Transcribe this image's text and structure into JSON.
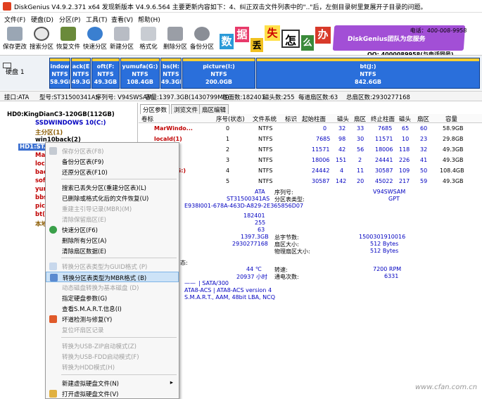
{
  "titlebar": {
    "text": "DiskGenius V4.9.2.371 x64    发现新版本 V4.9.6.564 主要更新内容如下：4、纠正双击文件列表中的\"..\"后，左侧目录树里复展开子目录的问题。"
  },
  "menu": [
    "文件(F)",
    "硬盘(D)",
    "分区(P)",
    "工具(T)",
    "查看(V)",
    "帮助(H)"
  ],
  "toolbar": [
    "保存更改",
    "搜索分区",
    "恢复文件",
    "快速分区",
    "新建分区",
    "格式化",
    "删除分区",
    "备份分区"
  ],
  "banner": {
    "chars": [
      "数",
      "据",
      "丢",
      "失",
      "怎",
      "么",
      "办"
    ],
    "team": "DiskGenius团队为您服务",
    "phone": "电话：400-008-9958",
    "qq": "QQ: 4000089958(与电话同号)"
  },
  "disk_label": {
    "line1": "硬盘 1"
  },
  "partitions": [
    {
      "name": "indow",
      "fs": "NTFS",
      "size": "58.9GB"
    },
    {
      "name": "ack(E",
      "fs": "NTFS",
      "size": "49.3GB"
    },
    {
      "name": "oft(F:",
      "fs": "NTFS",
      "size": "49.3GB"
    },
    {
      "name": "yumufa(G:)",
      "fs": "NTFS",
      "size": "108.4GB"
    },
    {
      "name": "bs(H:",
      "fs": "NTFS",
      "size": "49.3GB"
    },
    {
      "name": "picture(I:)",
      "fs": "NTFS",
      "size": "200.0GB"
    },
    {
      "name": "bt(J:)",
      "fs": "NTFS",
      "size": "842.6GB"
    }
  ],
  "infobar": {
    "iface": "接口:ATA",
    "model": "型号:ST31500341AS",
    "serial": "序列号: V94SWSAM",
    "capacity": "容量:1397.3GB(1430799MB)",
    "cyl": "柱面数:182401",
    "heads": "磁头数:255",
    "spt": "每道扇区数:63",
    "sectors": "总扇区数:2930277168"
  },
  "tree": [
    {
      "text": "HD0:KingDianC3-120GB(112GB)"
    },
    {
      "text": "SSDWINDOWS 10(C:)"
    },
    {
      "text": "主分区(1)"
    },
    {
      "text": "win10back(2)"
    },
    {
      "text": "HD1:ST..."
    },
    {
      "text": "Mar"
    },
    {
      "text": "loc"
    },
    {
      "text": "bac"
    },
    {
      "text": "sof"
    },
    {
      "text": "yum"
    },
    {
      "text": "bbs"
    },
    {
      "text": "pic"
    },
    {
      "text": "bt("
    },
    {
      "text": "本地"
    }
  ],
  "tabs": [
    "分区参数",
    "浏览文件",
    "扇区编辑"
  ],
  "table": {
    "headers": [
      "卷标",
      "序号(状态)",
      "文件系统",
      "标识",
      "起始柱面",
      "磁头",
      "扇区",
      "终止柱面",
      "磁头",
      "扇区",
      "容量"
    ],
    "rows": [
      [
        "MarWindo...",
        "0",
        "NTFS",
        "",
        "0",
        "32",
        "33",
        "7685",
        "65",
        "60",
        "58.9GB"
      ],
      [
        "locald(1)",
        "1",
        "NTFS",
        "",
        "7685",
        "98",
        "30",
        "11571",
        "10",
        "23",
        "29.8GB"
      ],
      [
        ":)",
        "2",
        "NTFS",
        "",
        "11571",
        "42",
        "56",
        "18006",
        "118",
        "32",
        "49.3GB"
      ],
      [
        ":)",
        "3",
        "NTFS",
        "",
        "18006",
        "151",
        "2",
        "24441",
        "226",
        "41",
        "49.3GB"
      ],
      [
        "(G:)",
        "4",
        "NTFS",
        "",
        "24442",
        "4",
        "11",
        "30587",
        "109",
        "50",
        "108.4GB"
      ],
      [
        ")",
        "5",
        "NTFS",
        "",
        "30587",
        "142",
        "20",
        "45022",
        "217",
        "59",
        "49.3GB"
      ]
    ]
  },
  "details": {
    "ata": "ATA",
    "model_val": "ST31500341AS",
    "guid": "E938I001-678A-463D-A829-2E365856D07",
    "sn_label": "序列号:",
    "sn_val": "V94SWSAM",
    "pt_label": "分区表类型:",
    "pt_val": "GPT",
    "cyl": "182401",
    "heads": "255",
    "spt": "63",
    "cap": "1397.3GB",
    "sectors": "2930277168",
    "total_bytes_label": "总字节数:",
    "total_bytes_val": "1500301910016",
    "sector_size_label": "扇区大小:",
    "sector_size_val": "512 Bytes",
    "phys_sector_label": "物理扇区大小:",
    "phys_sector_val": "512 Bytes",
    "temp": "44 ℃",
    "hours": "20937 小时",
    "sata": "| SATA/300",
    "ata_ver": "ATA8-ACS | ATA8-ACS version 4",
    "smart": "S.M.A.R.T., AAM, 48bit LBA, NCQ",
    "rpm_label": "转速:",
    "rpm_val": "7200 RPM",
    "poweron_label": "通电次数:",
    "poweron_val": "6331",
    "state": "态:"
  },
  "context_menu": [
    {
      "label": "保存分区表(F8)",
      "disabled": true
    },
    {
      "label": "备份分区表(F9)",
      "disabled": false
    },
    {
      "label": "还原分区表(F10)",
      "disabled": false
    },
    {
      "label": "搜索已丢失分区(重建分区表)(L)",
      "disabled": false
    },
    {
      "label": "已删除或格式化后的文件恢复(U)",
      "disabled": false
    },
    {
      "label": "重建主引导记录(MBR)(M)",
      "disabled": true
    },
    {
      "label": "清除保留扇区(E)",
      "disabled": true
    },
    {
      "label": "快速分区(F6)",
      "disabled": false
    },
    {
      "label": "删除所有分区(A)",
      "disabled": false
    },
    {
      "label": "清除扇区数据(E)",
      "disabled": false
    },
    {
      "label": "转换分区表类型为GUID格式 (P)",
      "disabled": true
    },
    {
      "label": "转换分区表类型为MBR格式 (B)",
      "disabled": false,
      "highlight": true
    },
    {
      "label": "动态磁盘转换为基本磁盘 (D)",
      "disabled": true
    },
    {
      "label": "指定硬盘参数(G)",
      "disabled": false
    },
    {
      "label": "查看S.M.A.R.T.信息(I)",
      "disabled": false
    },
    {
      "label": "坏道检测与修复(Y)",
      "disabled": false
    },
    {
      "label": "复位坏扇区记录",
      "disabled": true
    },
    {
      "label": "转换为USB-ZIP启动模式(Z)",
      "disabled": true
    },
    {
      "label": "转换为USB-FDD启动模式(F)",
      "disabled": true
    },
    {
      "label": "转换为HDD模式(H)",
      "disabled": true
    },
    {
      "label": "新建虚拟硬盘文件(N)",
      "disabled": false,
      "submenu": "▸"
    },
    {
      "label": "打开虚拟硬盘文件(V)",
      "disabled": false
    }
  ],
  "watermark": "www.cfan.com.cn"
}
